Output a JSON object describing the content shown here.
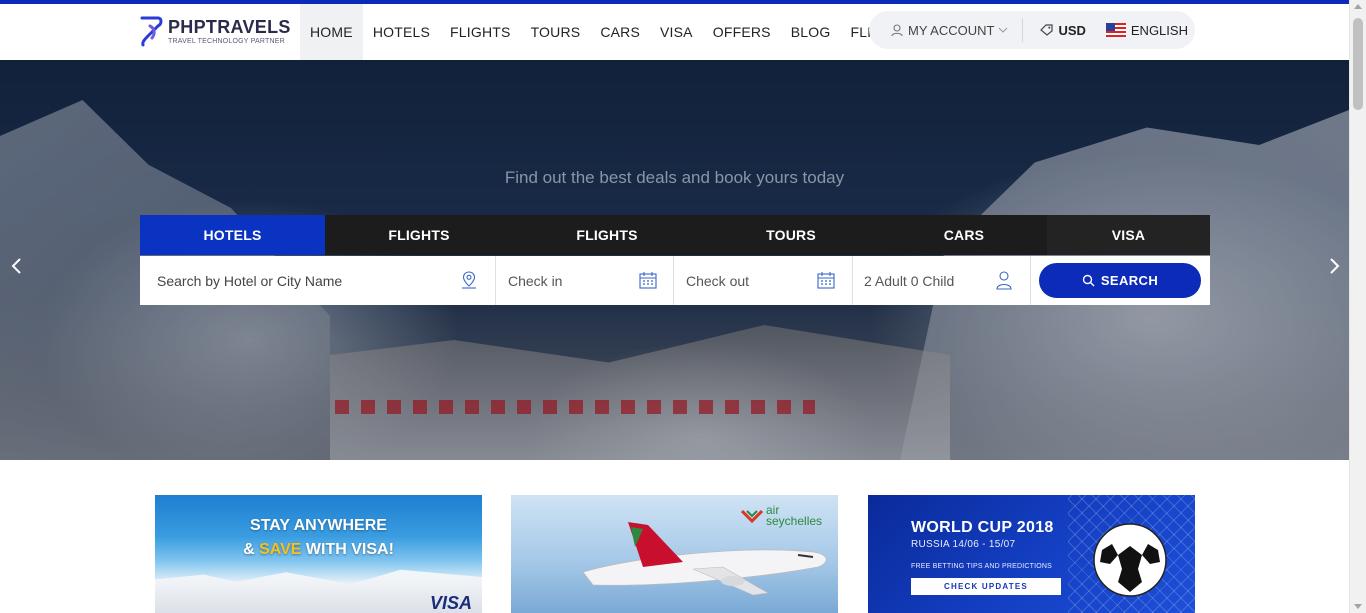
{
  "brand": {
    "name": "PHPTRAVELS",
    "tagline": "TRAVEL TECHNOLOGY PARTNER"
  },
  "nav": {
    "items": [
      {
        "label": "HOME"
      },
      {
        "label": "HOTELS"
      },
      {
        "label": "FLIGHTS"
      },
      {
        "label": "TOURS"
      },
      {
        "label": "CARS"
      },
      {
        "label": "VISA"
      },
      {
        "label": "OFFERS"
      },
      {
        "label": "BLOG"
      },
      {
        "label": "FLIGHTS"
      }
    ],
    "active": "HOME"
  },
  "account": {
    "my_account": "MY ACCOUNT",
    "currency": "USD",
    "language": "ENGLISH"
  },
  "hero": {
    "tagline": "Find out the best deals and book yours today"
  },
  "search_tabs": [
    {
      "label": "HOTELS"
    },
    {
      "label": "FLIGHTS"
    },
    {
      "label": "FLIGHTS"
    },
    {
      "label": "TOURS"
    },
    {
      "label": "CARS"
    },
    {
      "label": "VISA"
    }
  ],
  "search": {
    "city_placeholder": "Search by Hotel or City Name",
    "checkin_placeholder": "Check in",
    "checkout_placeholder": "Check out",
    "guests": "2 Adult 0 Child",
    "button": "SEARCH"
  },
  "promos": {
    "visa": {
      "line1": "STAY ANYWHERE",
      "line2_pre": "& ",
      "line2_save": "SAVE",
      "line2_post": " WITH VISA!",
      "brand": "VISA"
    },
    "air": {
      "brand_line1": "air",
      "brand_line2": "seychelles"
    },
    "worldcup": {
      "title": "WORLD CUP 2018",
      "subtitle": "RUSSIA 14/06 - 15/07",
      "tips": "FREE BETTING TIPS AND PREDICTIONS",
      "button": "CHECK UPDATES"
    }
  },
  "colors": {
    "accent": "#0b33c2",
    "tab_bg": "#1c1c1c",
    "top_line": "#0a2bb8"
  }
}
